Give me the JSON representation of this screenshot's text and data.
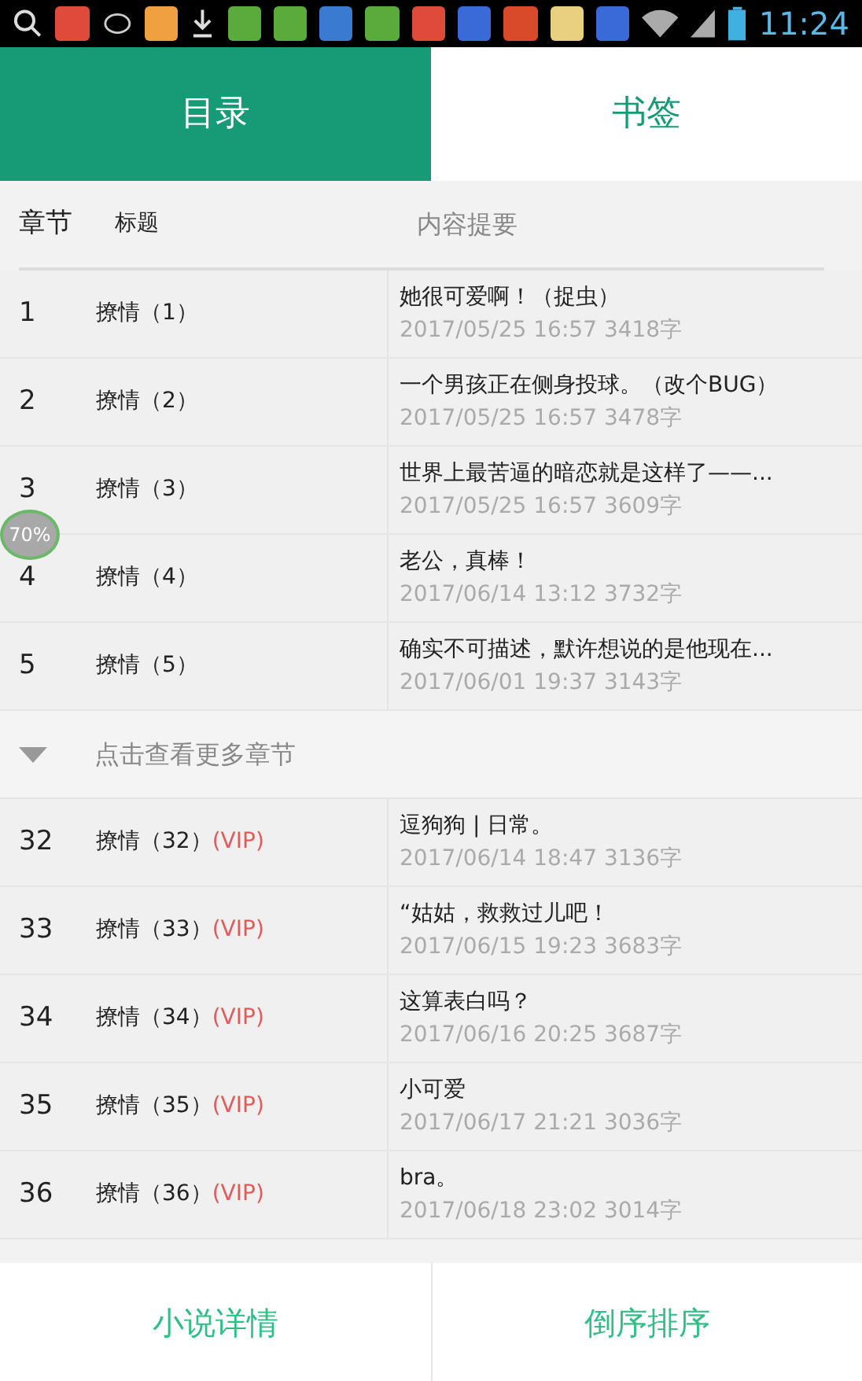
{
  "status_bar": {
    "time": "11:24"
  },
  "tabs": [
    {
      "label": "目录",
      "selected": true
    },
    {
      "label": "书签",
      "selected": false
    }
  ],
  "columns": [
    "章节",
    "标题",
    "内容提要"
  ],
  "progress_badge": "70%",
  "rows": [
    {
      "kind": "chapter",
      "number": "1",
      "title": "撩情（1）",
      "summary": "她很可爱啊！（捉虫）",
      "meta": "2017/05/25 16:57 3418字"
    },
    {
      "kind": "chapter",
      "number": "2",
      "title": "撩情（2）",
      "summary": "一个男孩正在侧身投球。（改个BUG）",
      "meta": "2017/05/25 16:57 3478字"
    },
    {
      "kind": "chapter",
      "number": "3",
      "title": "撩情（3）",
      "summary": "世界上最苦逼的暗恋就是这样了——...",
      "meta": "2017/05/25 16:57 3609字"
    },
    {
      "kind": "chapter",
      "number": "4",
      "title": "撩情（4）",
      "summary": "老公，真棒！",
      "meta": "2017/06/14 13:12 3732字"
    },
    {
      "kind": "chapter",
      "number": "5",
      "title": "撩情（5）",
      "summary": "确实不可描述，默许想说的是他现在...",
      "meta": "2017/06/01 19:37 3143字"
    },
    {
      "kind": "more",
      "label": "点击查看更多章节"
    },
    {
      "kind": "chapter",
      "number": "32",
      "title": "撩情（32）",
      "vip": "(VIP)",
      "summary": "逗狗狗 | 日常。",
      "meta": "2017/06/14 18:47 3136字"
    },
    {
      "kind": "chapter",
      "number": "33",
      "title": "撩情（33）",
      "vip": "(VIP)",
      "summary": "“姑姑，救救过儿吧！",
      "meta": "2017/06/15 19:23 3683字"
    },
    {
      "kind": "chapter",
      "number": "34",
      "title": "撩情（34）",
      "vip": "(VIP)",
      "summary": "这算表白吗？",
      "meta": "2017/06/16 20:25 3687字"
    },
    {
      "kind": "chapter",
      "number": "35",
      "title": "撩情（35）",
      "vip": "(VIP)",
      "summary": "小可爱",
      "meta": "2017/06/17 21:21 3036字"
    },
    {
      "kind": "chapter",
      "number": "36",
      "title": "撩情（36）",
      "vip": "(VIP)",
      "summary": "bra。",
      "meta": "2017/06/18 23:02 3014字"
    }
  ],
  "bottom_buttons": [
    "小说详情",
    "倒序排序"
  ]
}
